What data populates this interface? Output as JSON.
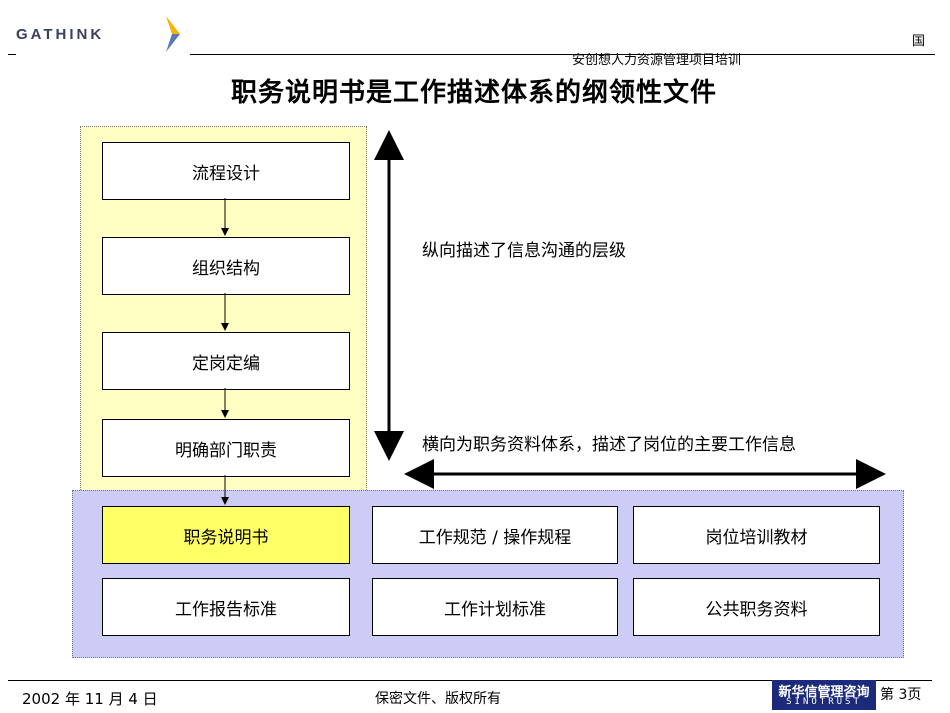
{
  "header": {
    "logo": "GATHINK",
    "corner_char": "国",
    "subtitle": "安创想人力资源管理项目培训"
  },
  "title": "职务说明书是工作描述体系的纲领性文件",
  "flow": [
    {
      "label": "流程设计"
    },
    {
      "label": "组织结构"
    },
    {
      "label": "定岗定编"
    },
    {
      "label": "明确部门职责"
    }
  ],
  "documents": {
    "row1": [
      "职务说明书",
      "工作规范 / 操作规程",
      "岗位培训教材"
    ],
    "row2": [
      "工作报告标准",
      "工作计划标准",
      "公共职务资料"
    ]
  },
  "annotations": {
    "vertical": "纵向描述了信息沟通的层级",
    "horizontal": "横向为职务资料体系，描述了岗位的主要工作信息"
  },
  "footer": {
    "date": "2002 年 11 月 4 日",
    "confidential": "保密文件、版权所有",
    "brand_cn": "新华信管理咨询",
    "brand_en": "SINOTRUST",
    "page": "第 3页"
  },
  "colors": {
    "yellow_panel": "#ffffc4",
    "blue_panel": "#ccccf6",
    "highlight_box": "#ffff66",
    "brand": "#1b2a7a"
  }
}
